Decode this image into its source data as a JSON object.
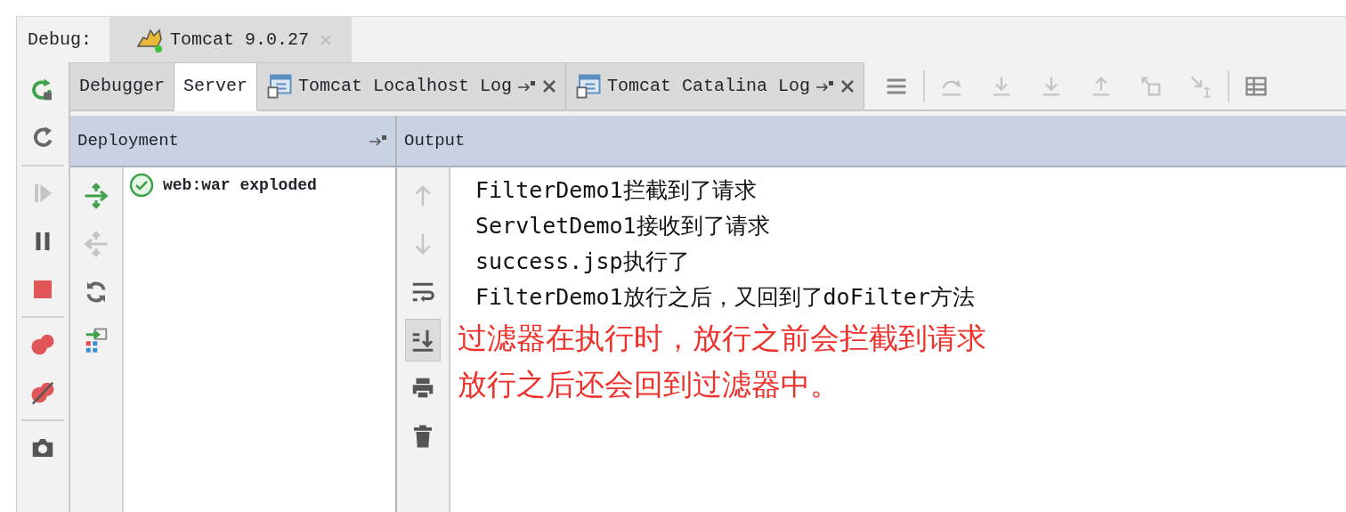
{
  "debug_label": "Debug:",
  "session_tabs": [
    {
      "label": "Tomcat 9.0.27",
      "selected": true
    }
  ],
  "left_toolbar": [
    [
      {
        "kind": "rerun",
        "disabled": false
      },
      {
        "kind": "restart",
        "disabled": false
      }
    ],
    [
      {
        "kind": "resume",
        "disabled": true
      },
      {
        "kind": "pause",
        "disabled": false
      },
      {
        "kind": "stop",
        "disabled": false
      }
    ],
    [
      {
        "kind": "breakpoints",
        "disabled": false
      },
      {
        "kind": "mute",
        "disabled": false
      }
    ],
    [
      {
        "kind": "camera",
        "disabled": false
      }
    ]
  ],
  "tabs": [
    {
      "label": "Debugger",
      "selected": false,
      "kind": "plain"
    },
    {
      "label": "Server",
      "selected": true,
      "kind": "plain"
    },
    {
      "label": "Tomcat Localhost Log",
      "selected": false,
      "kind": "log"
    },
    {
      "label": "Tomcat Catalina Log",
      "selected": false,
      "kind": "log"
    }
  ],
  "top_toolbar": [
    [
      {
        "kind": "menu",
        "disabled": false
      }
    ],
    [
      {
        "kind": "step_over",
        "disabled": true
      },
      {
        "kind": "step_into",
        "disabled": true
      },
      {
        "kind": "force_step_into",
        "disabled": true
      },
      {
        "kind": "step_out",
        "disabled": true
      },
      {
        "kind": "drop_frame",
        "disabled": true
      },
      {
        "kind": "run_to_cursor",
        "disabled": true
      }
    ],
    [
      {
        "kind": "grid",
        "disabled": false
      }
    ]
  ],
  "deployment": {
    "title": "Deployment",
    "toolbar": [
      {
        "kind": "deploy",
        "disabled": false
      },
      {
        "kind": "undeploy",
        "disabled": true
      },
      {
        "kind": "refresh",
        "disabled": false
      },
      {
        "kind": "artifact",
        "disabled": false
      }
    ],
    "items": [
      {
        "label": "web:war exploded",
        "deployed": true
      }
    ]
  },
  "output": {
    "title": "Output",
    "toolbar": [
      {
        "kind": "up",
        "disabled": true,
        "on": false
      },
      {
        "kind": "down",
        "disabled": true,
        "on": false
      },
      {
        "kind": "wrap",
        "disabled": false,
        "on": false
      },
      {
        "kind": "scroll_end",
        "disabled": false,
        "on": true
      },
      {
        "kind": "print",
        "disabled": false,
        "on": false
      },
      {
        "kind": "trash",
        "disabled": false,
        "on": false
      }
    ],
    "lines": [
      {
        "kind": "log",
        "text": "FilterDemo1拦截到了请求"
      },
      {
        "kind": "log",
        "text": "ServletDemo1接收到了请求"
      },
      {
        "kind": "log",
        "text": "success.jsp执行了"
      },
      {
        "kind": "log",
        "text": "FilterDemo1放行之后，又回到了doFilter方法"
      },
      {
        "kind": "note",
        "text": "过滤器在执行时，放行之前会拦截到请求"
      },
      {
        "kind": "note",
        "text": "放行之后还会回到过滤器中。"
      }
    ]
  }
}
